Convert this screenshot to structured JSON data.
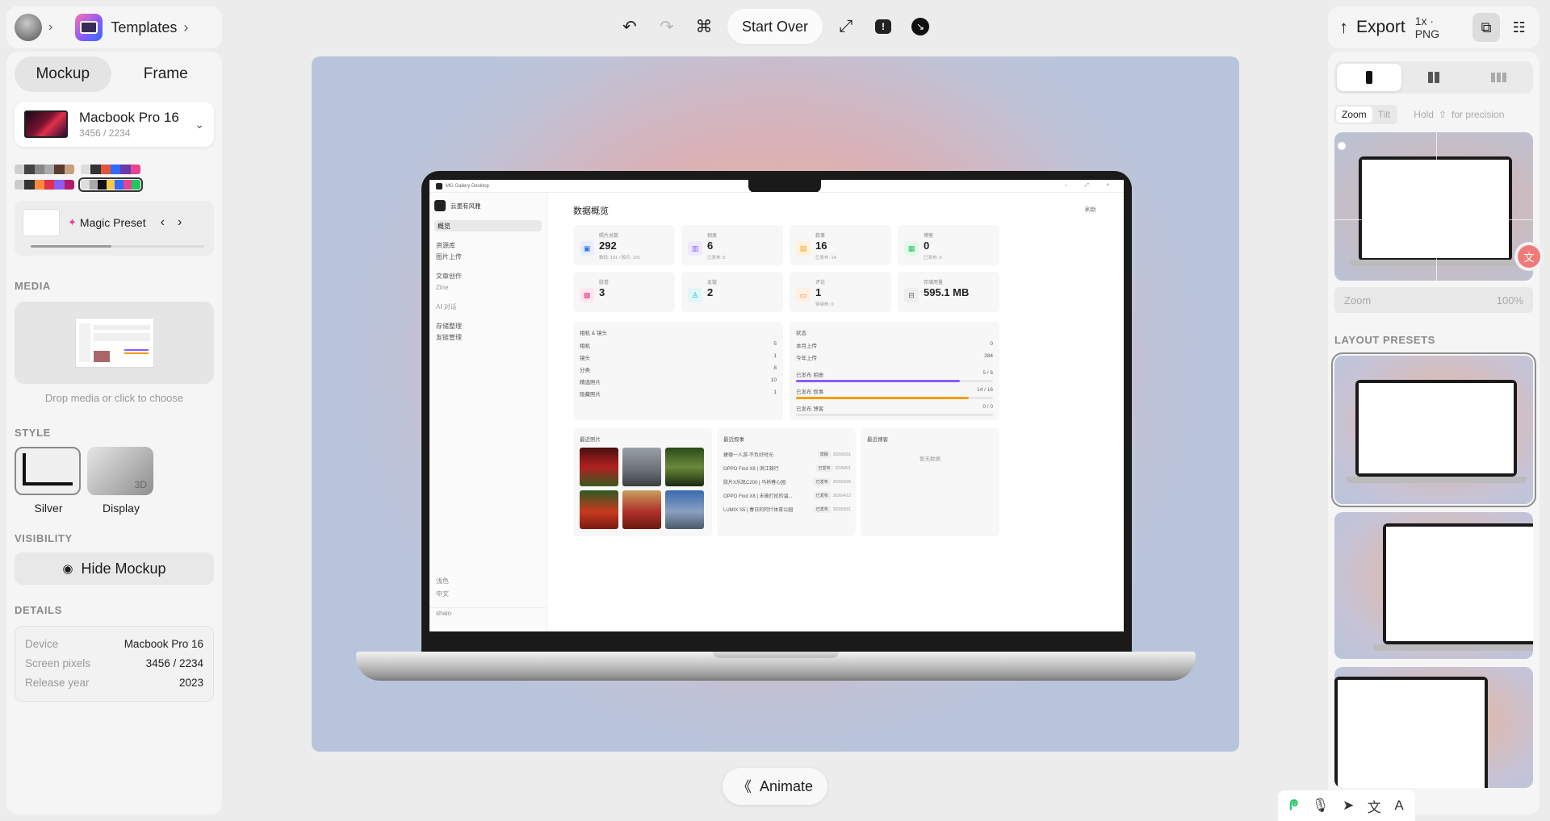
{
  "header": {
    "templates_label": "Templates",
    "start_over_label": "Start Over",
    "export_label": "Export",
    "export_format": "1x · PNG"
  },
  "left": {
    "tabs": [
      "Mockup",
      "Frame"
    ],
    "device": {
      "name": "Macbook Pro 16",
      "resolution": "3456 / 2234"
    },
    "magic_preset_label": "Magic Preset",
    "media_label": "MEDIA",
    "media_hint": "Drop media or click to choose",
    "style_label": "STYLE",
    "styles": [
      {
        "name": "Silver",
        "badge": ""
      },
      {
        "name": "Display",
        "badge": "3D"
      }
    ],
    "visibility_label": "VISIBILITY",
    "hide_mockup_label": "Hide Mockup",
    "details_label": "DETAILS",
    "details": [
      {
        "key": "Device",
        "value": "Macbook Pro 16"
      },
      {
        "key": "Screen pixels",
        "value": "3456 / 2234"
      },
      {
        "key": "Release year",
        "value": "2023"
      }
    ]
  },
  "right": {
    "zoom_tab": "Zoom",
    "tilt_tab": "Tilt",
    "hold_hint": "Hold",
    "hold_hint2": "for precision",
    "zoom_label": "Zoom",
    "zoom_value": "100%",
    "layout_presets_label": "LAYOUT PRESETS"
  },
  "animate_label": "Animate",
  "screen_app": {
    "window_title": "MG Gallery Desktop",
    "brand": "云墨有风雅",
    "nav": [
      "概览",
      "资源库",
      "图片上传",
      "文章创作",
      "Zine",
      "AI 对话",
      "存储整理",
      "友链管理"
    ],
    "footer_nav": [
      "浅色",
      "中文"
    ],
    "user": "shaio",
    "page_title": "数据概览",
    "refresh": "刷新",
    "stats": [
      {
        "title": "照片总数",
        "value": "292",
        "sub": "数码: 191 / 胶片: 101"
      },
      {
        "title": "相册",
        "value": "6",
        "sub": "已发布: 5"
      },
      {
        "title": "叙事",
        "value": "16",
        "sub": "已发布: 14"
      },
      {
        "title": "博客",
        "value": "0",
        "sub": "已发布: 0"
      },
      {
        "title": "胶卷",
        "value": "3",
        "sub": ""
      },
      {
        "title": "友链",
        "value": "2",
        "sub": ""
      },
      {
        "title": "评论",
        "value": "1",
        "sub": "待审核: 0"
      },
      {
        "title": "存储用量",
        "value": "595.1 MB",
        "sub": ""
      }
    ],
    "camera_title": "相机 & 镜头",
    "camera_rows": [
      {
        "k": "相机",
        "v": "5"
      },
      {
        "k": "镜头",
        "v": "1"
      },
      {
        "k": "分类",
        "v": "8"
      },
      {
        "k": "精选照片",
        "v": "10"
      },
      {
        "k": "隐藏照片",
        "v": "1"
      }
    ],
    "status_title": "状态",
    "status_rows": [
      {
        "k": "本月上传",
        "v": "0"
      },
      {
        "k": "今年上传",
        "v": "284"
      }
    ],
    "progress": [
      {
        "k": "已发布 相册",
        "v": "5 / 6",
        "pct": 0.83,
        "color": "#8b5cf6"
      },
      {
        "k": "已发布 叙事",
        "v": "14 / 16",
        "pct": 0.875,
        "color": "#f59e0b"
      },
      {
        "k": "已发布 博客",
        "v": "0 / 0",
        "pct": 0,
        "color": "#999999"
      }
    ],
    "recent_photos_title": "最近照片",
    "recent_stories_title": "最近叙事",
    "stories": [
      {
        "title": "建德一人游-不负好时光",
        "tag": "草稿",
        "date": "2026/5/31"
      },
      {
        "title": "OPPO Find X8 | 滨江骑行",
        "tag": "已发布",
        "date": "2026/5/1"
      },
      {
        "title": "胶片X乐凯C200 | 马桥春心园",
        "tag": "已发布",
        "date": "2026/4/26"
      },
      {
        "title": "OPPO Find X8 | 未被打扰的温...",
        "tag": "已发布",
        "date": "2026/4/12"
      },
      {
        "title": "LUMIX S5 | 春日的阿什体育公园",
        "tag": "已发布",
        "date": "2026/3/31"
      }
    ],
    "recent_blogs_title": "最近博客",
    "no_data": "暂无数据"
  }
}
